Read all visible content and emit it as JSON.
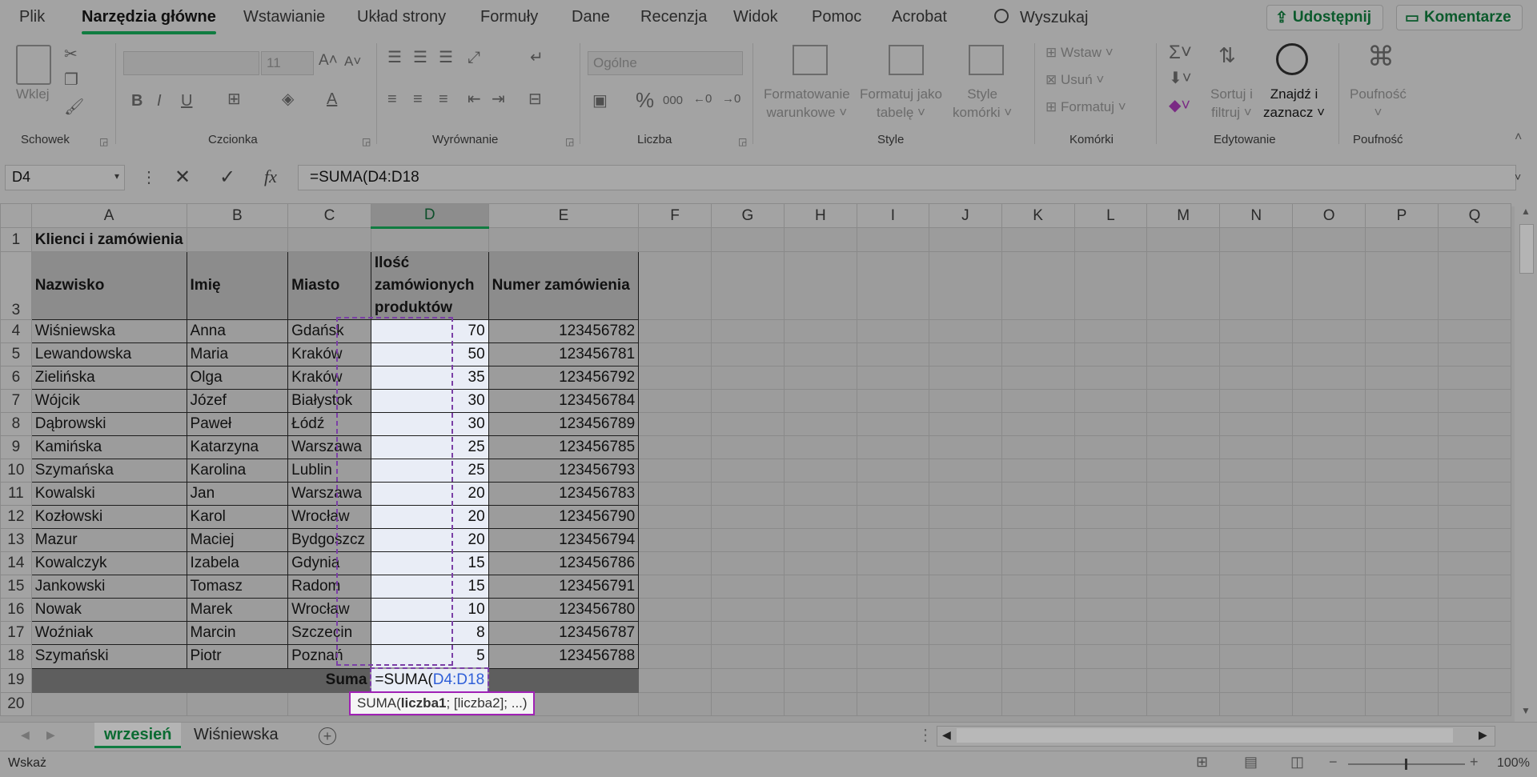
{
  "menu": {
    "items": [
      "Plik",
      "Narzędzia główne",
      "Wstawianie",
      "Układ strony",
      "Formuły",
      "Dane",
      "Recenzja",
      "Widok",
      "Pomoc",
      "Acrobat"
    ],
    "search_label": "Wyszukaj",
    "share_label": "Udostępnij",
    "comments_label": "Komentarze"
  },
  "ribbon": {
    "clipboard": {
      "paste": "Wklej",
      "label": "Schowek"
    },
    "font": {
      "size": "11",
      "bold": "B",
      "italic": "I",
      "underline": "U",
      "label": "Czcionka"
    },
    "alignment": {
      "label": "Wyrównanie"
    },
    "number": {
      "format": "Ogólne",
      "percent": "%",
      "thousands": "000",
      "label": "Liczba"
    },
    "styles": {
      "cond_format_1": "Formatowanie",
      "cond_format_2": "warunkowe",
      "table_fmt_1": "Formatuj jako",
      "table_fmt_2": "tabelę",
      "cell_styles_1": "Style",
      "cell_styles_2": "komórki",
      "label": "Style"
    },
    "cells": {
      "insert": "Wstaw",
      "delete": "Usuń",
      "format": "Formatuj",
      "label": "Komórki"
    },
    "editing": {
      "sort_1": "Sortuj i",
      "sort_2": "filtruj",
      "find_1": "Znajdź i",
      "find_2": "zaznacz",
      "label": "Edytowanie"
    },
    "sensitivity": {
      "button": "Poufność",
      "label": "Poufność"
    }
  },
  "formula_bar": {
    "name_box": "D4",
    "formula": "=SUMA(D4:D18"
  },
  "columns": [
    "A",
    "B",
    "C",
    "D",
    "E",
    "F",
    "G",
    "H",
    "I",
    "J",
    "K",
    "L",
    "M",
    "N",
    "O",
    "P",
    "Q"
  ],
  "sheet": {
    "title": "Klienci i zamówienia",
    "headers": {
      "surname": "Nazwisko",
      "name": "Imię",
      "city": "Miasto",
      "qty_1": "Ilość",
      "qty_2": "zamówionych",
      "qty_3": "produktów",
      "order": "Numer zamówienia"
    },
    "rows": [
      {
        "n": "4",
        "surname": "Wiśniewska",
        "name": "Anna",
        "city": "Gdańsk",
        "qty": "70",
        "order": "123456782"
      },
      {
        "n": "5",
        "surname": "Lewandowska",
        "name": "Maria",
        "city": "Kraków",
        "qty": "50",
        "order": "123456781"
      },
      {
        "n": "6",
        "surname": "Zielińska",
        "name": "Olga",
        "city": "Kraków",
        "qty": "35",
        "order": "123456792"
      },
      {
        "n": "7",
        "surname": "Wójcik",
        "name": "Józef",
        "city": "Białystok",
        "qty": "30",
        "order": "123456784"
      },
      {
        "n": "8",
        "surname": "Dąbrowski",
        "name": "Paweł",
        "city": "Łódź",
        "qty": "30",
        "order": "123456789"
      },
      {
        "n": "9",
        "surname": "Kamińska",
        "name": "Katarzyna",
        "city": "Warszawa",
        "qty": "25",
        "order": "123456785"
      },
      {
        "n": "10",
        "surname": "Szymańska",
        "name": "Karolina",
        "city": "Lublin",
        "qty": "25",
        "order": "123456793"
      },
      {
        "n": "11",
        "surname": "Kowalski",
        "name": "Jan",
        "city": "Warszawa",
        "qty": "20",
        "order": "123456783"
      },
      {
        "n": "12",
        "surname": "Kozłowski",
        "name": "Karol",
        "city": "Wrocław",
        "qty": "20",
        "order": "123456790"
      },
      {
        "n": "13",
        "surname": "Mazur",
        "name": "Maciej",
        "city": "Bydgoszcz",
        "qty": "20",
        "order": "123456794"
      },
      {
        "n": "14",
        "surname": "Kowalczyk",
        "name": "Izabela",
        "city": "Gdynia",
        "qty": "15",
        "order": "123456786"
      },
      {
        "n": "15",
        "surname": "Jankowski",
        "name": "Tomasz",
        "city": "Radom",
        "qty": "15",
        "order": "123456791"
      },
      {
        "n": "16",
        "surname": "Nowak",
        "name": "Marek",
        "city": "Wrocław",
        "qty": "10",
        "order": "123456780"
      },
      {
        "n": "17",
        "surname": "Woźniak",
        "name": "Marcin",
        "city": "Szczecin",
        "qty": "8",
        "order": "123456787"
      },
      {
        "n": "18",
        "surname": "Szymański",
        "name": "Piotr",
        "city": "Poznań",
        "qty": "5",
        "order": "123456788"
      }
    ],
    "sum_label": "Suma",
    "edit_prefix": "=SUMA(",
    "edit_ref": "D4:D18"
  },
  "tooltip": {
    "func": "SUMA(",
    "arg1": "liczba1",
    "rest": "; [liczba2]; ...)"
  },
  "tabs": [
    "wrzesień",
    "Wiśniewska"
  ],
  "status": {
    "mode": "Wskaż",
    "zoom": "100%"
  }
}
